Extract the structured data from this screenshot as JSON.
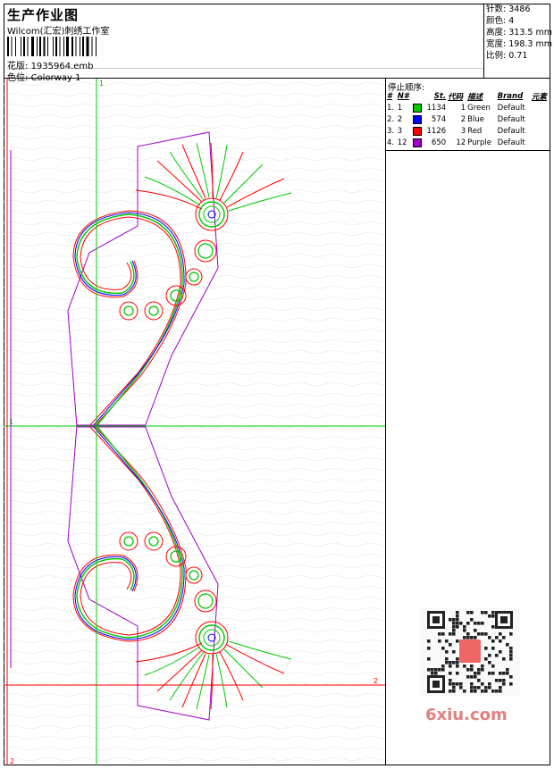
{
  "header": {
    "title": "生产作业图",
    "company": "Wilcom(汇宏)刺绣工作室",
    "file_label": "花版:",
    "file_value": "1935964.emb",
    "colorway_label": "色位:",
    "colorway_value": "Colorway 1"
  },
  "stats": [
    {
      "label": "针数:",
      "value": "3486"
    },
    {
      "label": "颜色:",
      "value": "4"
    },
    {
      "label": "高度:",
      "value": "313.5 mm"
    },
    {
      "label": "宽度:",
      "value": "198.3 mm"
    },
    {
      "label": "比例:",
      "value": "0.71"
    }
  ],
  "stop_sequence": {
    "title": "停止顺序:",
    "columns": [
      "#",
      "N#",
      "St.",
      "代码",
      "描述",
      "Brand",
      "元素"
    ],
    "rows": [
      {
        "idx": "1.",
        "n": "1",
        "color": "#00c800",
        "stitches": "1134",
        "code": "1",
        "desc": "Green",
        "brand": "Default"
      },
      {
        "idx": "2.",
        "n": "2",
        "color": "#0000ff",
        "stitches": "574",
        "code": "2",
        "desc": "Blue",
        "brand": "Default"
      },
      {
        "idx": "3.",
        "n": "3",
        "color": "#ff0000",
        "stitches": "1126",
        "code": "3",
        "desc": "Red",
        "brand": "Default"
      },
      {
        "idx": "4.",
        "n": "12",
        "color": "#a000c8",
        "stitches": "650",
        "code": "12",
        "desc": "Purple",
        "brand": "Default"
      }
    ]
  },
  "design_labels": {
    "axis_1_top": "1",
    "axis_1_left": "1",
    "axis_2_right": "2",
    "axis_2_bottom": "2"
  },
  "watermark": "6xiu.com",
  "colors": {
    "green": "#00c800",
    "blue": "#0000ff",
    "red": "#ff0000",
    "purple": "#a000c8",
    "guide_green": "#00cc00",
    "guide_red": "#ff0000"
  }
}
